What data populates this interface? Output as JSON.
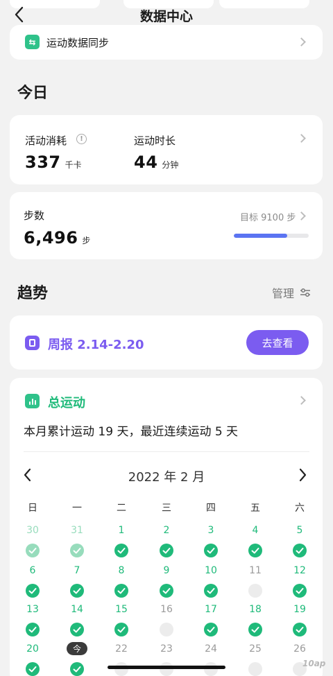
{
  "header": {
    "title": "数据中心"
  },
  "sync": {
    "label": "运动数据同步"
  },
  "today": {
    "title": "今日",
    "calories": {
      "label": "活动消耗",
      "value": "337",
      "unit": "千卡"
    },
    "duration": {
      "label": "运动时长",
      "value": "44",
      "unit": "分钟"
    },
    "steps": {
      "label": "步数",
      "value": "6,496",
      "unit": "步",
      "goal_text": "目标 9100 步",
      "progress_percent": 71
    }
  },
  "trend": {
    "title": "趋势",
    "manage_label": "管理"
  },
  "weekly": {
    "label": "周报 2.14-2.20",
    "view_label": "去查看"
  },
  "total": {
    "title": "总运动",
    "summary": "本月累计运动 19 天，最近连续运动 5 天",
    "month_label": "2022 年 2 月"
  },
  "calendar": {
    "weekdays": [
      "日",
      "一",
      "二",
      "三",
      "四",
      "五",
      "六"
    ],
    "rows": [
      [
        {
          "d": "30",
          "s": "prev"
        },
        {
          "d": "31",
          "s": "prev"
        },
        {
          "d": "1",
          "s": "done"
        },
        {
          "d": "2",
          "s": "done"
        },
        {
          "d": "3",
          "s": "done"
        },
        {
          "d": "4",
          "s": "done"
        },
        {
          "d": "5",
          "s": "done"
        }
      ],
      [
        {
          "d": "6",
          "s": "done"
        },
        {
          "d": "7",
          "s": "done"
        },
        {
          "d": "8",
          "s": "done"
        },
        {
          "d": "9",
          "s": "done"
        },
        {
          "d": "10",
          "s": "done"
        },
        {
          "d": "11",
          "s": "empty"
        },
        {
          "d": "12",
          "s": "done"
        }
      ],
      [
        {
          "d": "13",
          "s": "done"
        },
        {
          "d": "14",
          "s": "done"
        },
        {
          "d": "15",
          "s": "done"
        },
        {
          "d": "16",
          "s": "empty"
        },
        {
          "d": "17",
          "s": "done"
        },
        {
          "d": "18",
          "s": "done"
        },
        {
          "d": "19",
          "s": "done"
        }
      ],
      [
        {
          "d": "20",
          "s": "done"
        },
        {
          "d": "今",
          "s": "today"
        },
        {
          "d": "22",
          "s": "future"
        },
        {
          "d": "23",
          "s": "future"
        },
        {
          "d": "24",
          "s": "future"
        },
        {
          "d": "25",
          "s": "future"
        },
        {
          "d": "26",
          "s": "future"
        }
      ]
    ]
  },
  "watermark": {
    "text": "10ap"
  },
  "colors": {
    "green": "#1fba7a",
    "light_green": "#97dcbc",
    "purple": "#7b5cf0",
    "progress_blue": "#5b74f2",
    "gray_mark": "#ececec"
  }
}
